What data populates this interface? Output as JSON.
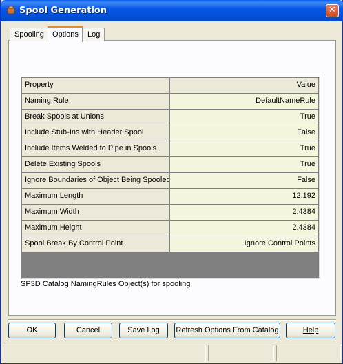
{
  "window": {
    "title": "Spool Generation",
    "close_glyph": "✕"
  },
  "tabs": [
    {
      "label": "Spooling",
      "active": false
    },
    {
      "label": "Options",
      "active": true
    },
    {
      "label": "Log",
      "active": false
    }
  ],
  "grid": {
    "header": {
      "property": "Property",
      "value": "Value"
    },
    "rows": [
      {
        "property": "Naming Rule",
        "value": "DefaultNameRule"
      },
      {
        "property": "Break Spools at Unions",
        "value": "True"
      },
      {
        "property": "Include Stub-Ins with Header Spool",
        "value": "False"
      },
      {
        "property": "Include Items Welded to Pipe in Spools",
        "value": "True"
      },
      {
        "property": "Delete Existing Spools",
        "value": "True"
      },
      {
        "property": "Ignore Boundaries of Object Being Spooled",
        "value": "False"
      },
      {
        "property": "Maximum Length",
        "value": "12.192"
      },
      {
        "property": "Maximum Width",
        "value": "2.4384"
      },
      {
        "property": "Maximum Height",
        "value": "2.4384"
      },
      {
        "property": "Spool Break By Control Point",
        "value": "Ignore Control Points"
      }
    ]
  },
  "description": "SP3D Catalog NamingRules Object(s) for spooling",
  "buttons": {
    "ok": "OK",
    "cancel": "Cancel",
    "save_log": "Save Log",
    "refresh": "Refresh Options From Catalog",
    "help": "Help"
  },
  "icons": {
    "app": "spool-icon",
    "close": "close-icon"
  }
}
